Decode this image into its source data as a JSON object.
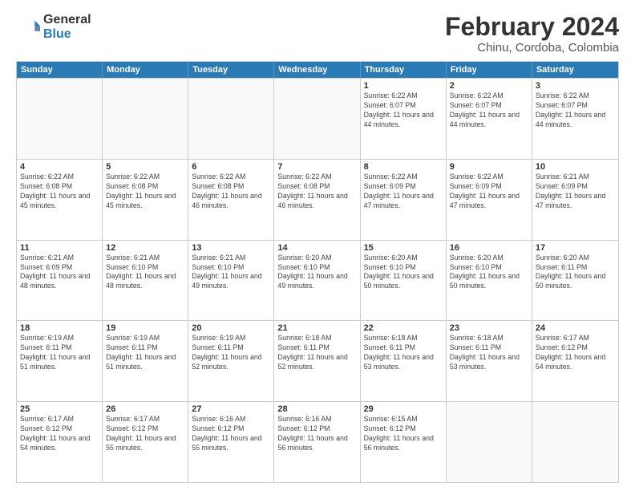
{
  "logo": {
    "general": "General",
    "blue": "Blue"
  },
  "header": {
    "month_year": "February 2024",
    "location": "Chinu, Cordoba, Colombia"
  },
  "weekdays": [
    "Sunday",
    "Monday",
    "Tuesday",
    "Wednesday",
    "Thursday",
    "Friday",
    "Saturday"
  ],
  "rows": [
    [
      {
        "day": "",
        "sunrise": "",
        "sunset": "",
        "daylight": "",
        "empty": true
      },
      {
        "day": "",
        "sunrise": "",
        "sunset": "",
        "daylight": "",
        "empty": true
      },
      {
        "day": "",
        "sunrise": "",
        "sunset": "",
        "daylight": "",
        "empty": true
      },
      {
        "day": "",
        "sunrise": "",
        "sunset": "",
        "daylight": "",
        "empty": true
      },
      {
        "day": "1",
        "sunrise": "Sunrise: 6:22 AM",
        "sunset": "Sunset: 6:07 PM",
        "daylight": "Daylight: 11 hours and 44 minutes.",
        "empty": false
      },
      {
        "day": "2",
        "sunrise": "Sunrise: 6:22 AM",
        "sunset": "Sunset: 6:07 PM",
        "daylight": "Daylight: 11 hours and 44 minutes.",
        "empty": false
      },
      {
        "day": "3",
        "sunrise": "Sunrise: 6:22 AM",
        "sunset": "Sunset: 6:07 PM",
        "daylight": "Daylight: 11 hours and 44 minutes.",
        "empty": false
      }
    ],
    [
      {
        "day": "4",
        "sunrise": "Sunrise: 6:22 AM",
        "sunset": "Sunset: 6:08 PM",
        "daylight": "Daylight: 11 hours and 45 minutes.",
        "empty": false
      },
      {
        "day": "5",
        "sunrise": "Sunrise: 6:22 AM",
        "sunset": "Sunset: 6:08 PM",
        "daylight": "Daylight: 11 hours and 45 minutes.",
        "empty": false
      },
      {
        "day": "6",
        "sunrise": "Sunrise: 6:22 AM",
        "sunset": "Sunset: 6:08 PM",
        "daylight": "Daylight: 11 hours and 46 minutes.",
        "empty": false
      },
      {
        "day": "7",
        "sunrise": "Sunrise: 6:22 AM",
        "sunset": "Sunset: 6:08 PM",
        "daylight": "Daylight: 11 hours and 46 minutes.",
        "empty": false
      },
      {
        "day": "8",
        "sunrise": "Sunrise: 6:22 AM",
        "sunset": "Sunset: 6:09 PM",
        "daylight": "Daylight: 11 hours and 47 minutes.",
        "empty": false
      },
      {
        "day": "9",
        "sunrise": "Sunrise: 6:22 AM",
        "sunset": "Sunset: 6:09 PM",
        "daylight": "Daylight: 11 hours and 47 minutes.",
        "empty": false
      },
      {
        "day": "10",
        "sunrise": "Sunrise: 6:21 AM",
        "sunset": "Sunset: 6:09 PM",
        "daylight": "Daylight: 11 hours and 47 minutes.",
        "empty": false
      }
    ],
    [
      {
        "day": "11",
        "sunrise": "Sunrise: 6:21 AM",
        "sunset": "Sunset: 6:09 PM",
        "daylight": "Daylight: 11 hours and 48 minutes.",
        "empty": false
      },
      {
        "day": "12",
        "sunrise": "Sunrise: 6:21 AM",
        "sunset": "Sunset: 6:10 PM",
        "daylight": "Daylight: 11 hours and 48 minutes.",
        "empty": false
      },
      {
        "day": "13",
        "sunrise": "Sunrise: 6:21 AM",
        "sunset": "Sunset: 6:10 PM",
        "daylight": "Daylight: 11 hours and 49 minutes.",
        "empty": false
      },
      {
        "day": "14",
        "sunrise": "Sunrise: 6:20 AM",
        "sunset": "Sunset: 6:10 PM",
        "daylight": "Daylight: 11 hours and 49 minutes.",
        "empty": false
      },
      {
        "day": "15",
        "sunrise": "Sunrise: 6:20 AM",
        "sunset": "Sunset: 6:10 PM",
        "daylight": "Daylight: 11 hours and 50 minutes.",
        "empty": false
      },
      {
        "day": "16",
        "sunrise": "Sunrise: 6:20 AM",
        "sunset": "Sunset: 6:10 PM",
        "daylight": "Daylight: 11 hours and 50 minutes.",
        "empty": false
      },
      {
        "day": "17",
        "sunrise": "Sunrise: 6:20 AM",
        "sunset": "Sunset: 6:11 PM",
        "daylight": "Daylight: 11 hours and 50 minutes.",
        "empty": false
      }
    ],
    [
      {
        "day": "18",
        "sunrise": "Sunrise: 6:19 AM",
        "sunset": "Sunset: 6:11 PM",
        "daylight": "Daylight: 11 hours and 51 minutes.",
        "empty": false
      },
      {
        "day": "19",
        "sunrise": "Sunrise: 6:19 AM",
        "sunset": "Sunset: 6:11 PM",
        "daylight": "Daylight: 11 hours and 51 minutes.",
        "empty": false
      },
      {
        "day": "20",
        "sunrise": "Sunrise: 6:19 AM",
        "sunset": "Sunset: 6:11 PM",
        "daylight": "Daylight: 11 hours and 52 minutes.",
        "empty": false
      },
      {
        "day": "21",
        "sunrise": "Sunrise: 6:18 AM",
        "sunset": "Sunset: 6:11 PM",
        "daylight": "Daylight: 11 hours and 52 minutes.",
        "empty": false
      },
      {
        "day": "22",
        "sunrise": "Sunrise: 6:18 AM",
        "sunset": "Sunset: 6:11 PM",
        "daylight": "Daylight: 11 hours and 53 minutes.",
        "empty": false
      },
      {
        "day": "23",
        "sunrise": "Sunrise: 6:18 AM",
        "sunset": "Sunset: 6:11 PM",
        "daylight": "Daylight: 11 hours and 53 minutes.",
        "empty": false
      },
      {
        "day": "24",
        "sunrise": "Sunrise: 6:17 AM",
        "sunset": "Sunset: 6:12 PM",
        "daylight": "Daylight: 11 hours and 54 minutes.",
        "empty": false
      }
    ],
    [
      {
        "day": "25",
        "sunrise": "Sunrise: 6:17 AM",
        "sunset": "Sunset: 6:12 PM",
        "daylight": "Daylight: 11 hours and 54 minutes.",
        "empty": false
      },
      {
        "day": "26",
        "sunrise": "Sunrise: 6:17 AM",
        "sunset": "Sunset: 6:12 PM",
        "daylight": "Daylight: 11 hours and 55 minutes.",
        "empty": false
      },
      {
        "day": "27",
        "sunrise": "Sunrise: 6:16 AM",
        "sunset": "Sunset: 6:12 PM",
        "daylight": "Daylight: 11 hours and 55 minutes.",
        "empty": false
      },
      {
        "day": "28",
        "sunrise": "Sunrise: 6:16 AM",
        "sunset": "Sunset: 6:12 PM",
        "daylight": "Daylight: 11 hours and 56 minutes.",
        "empty": false
      },
      {
        "day": "29",
        "sunrise": "Sunrise: 6:15 AM",
        "sunset": "Sunset: 6:12 PM",
        "daylight": "Daylight: 11 hours and 56 minutes.",
        "empty": false
      },
      {
        "day": "",
        "sunrise": "",
        "sunset": "",
        "daylight": "",
        "empty": true
      },
      {
        "day": "",
        "sunrise": "",
        "sunset": "",
        "daylight": "",
        "empty": true
      }
    ]
  ]
}
